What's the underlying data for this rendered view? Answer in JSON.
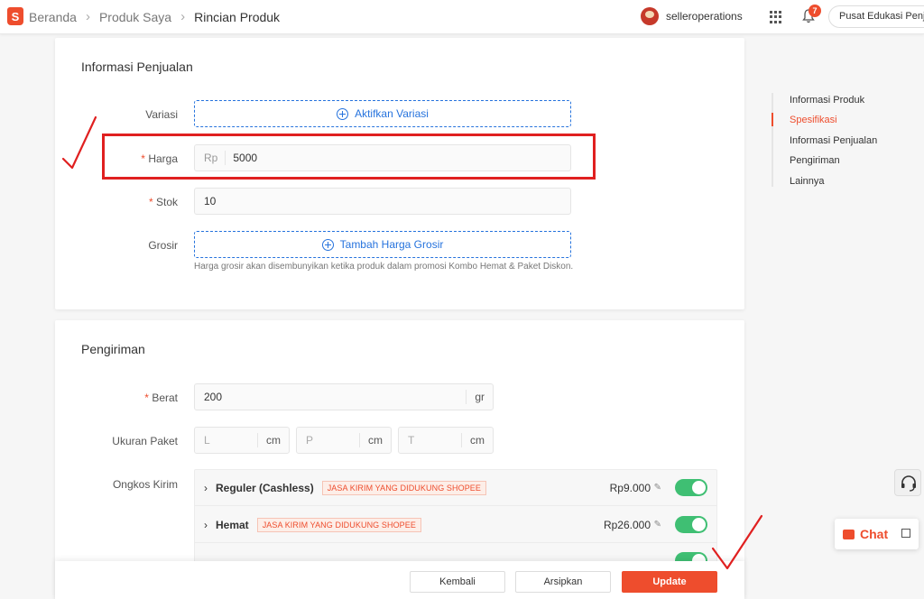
{
  "header": {
    "logo_letter": "S",
    "breadcrumb": [
      "Beranda",
      "Produk Saya",
      "Rincian Produk"
    ],
    "breadcrumb_separator": "›",
    "username": "selleroperations",
    "notification_count": "7",
    "education_button": "Pusat Edukasi Penjual"
  },
  "sales_section": {
    "title": "Informasi Penjualan",
    "variation_label": "Variasi",
    "variation_button": "Aktifkan Variasi",
    "price_label": "Harga",
    "price_prefix": "Rp",
    "price_value": "5000",
    "stock_label": "Stok",
    "stock_value": "10",
    "wholesale_label": "Grosir",
    "wholesale_button": "Tambah Harga Grosir",
    "wholesale_hint": "Harga grosir akan disembunyikan ketika produk dalam promosi Kombo Hemat & Paket Diskon.",
    "required_mark": "*"
  },
  "shipping_section": {
    "title": "Pengiriman",
    "weight_label": "Berat",
    "weight_value": "200",
    "weight_unit": "gr",
    "package_label": "Ukuran Paket",
    "dims": [
      {
        "placeholder": "L",
        "unit": "cm"
      },
      {
        "placeholder": "P",
        "unit": "cm"
      },
      {
        "placeholder": "T",
        "unit": "cm"
      }
    ],
    "shipping_cost_label": "Ongkos Kirim",
    "options": [
      {
        "name": "Reguler (Cashless)",
        "tag": "JASA KIRIM YANG DIDUKUNG SHOPEE",
        "price": "Rp9.000",
        "enabled": true
      },
      {
        "name": "Hemat",
        "tag": "JASA KIRIM YANG DIDUKUNG SHOPEE",
        "price": "Rp26.000",
        "enabled": true
      }
    ]
  },
  "side_nav": {
    "items": [
      "Informasi Produk",
      "Spesifikasi",
      "Informasi Penjualan",
      "Pengiriman",
      "Lainnya"
    ],
    "active": "Spesifikasi"
  },
  "footer": {
    "back_button": "Kembali",
    "archive_button": "Arsipkan",
    "update_button": "Update"
  },
  "chat": {
    "label": "Chat"
  },
  "colors": {
    "brand": "#ee4d2d",
    "link": "#2673dd",
    "toggle_on": "#3fbf73",
    "annotation": "#e02020"
  }
}
